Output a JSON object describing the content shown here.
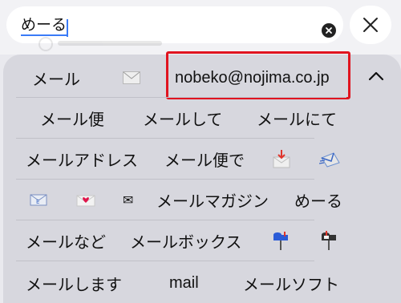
{
  "search": {
    "value": "めーる"
  },
  "candidates_row1": [
    {
      "label": "メール"
    },
    {
      "icon": "envelope-icon"
    },
    {
      "label": "nobeko@nojima.co.jp"
    }
  ],
  "candidates_row2": [
    "メール便",
    "メールして",
    "メールにて"
  ],
  "candidates_row3": [
    {
      "label": "メールアドレス"
    },
    {
      "label": "メール便で"
    },
    {
      "icon": "envelope-with-arrow-icon"
    },
    {
      "icon": "incoming-envelope-icon"
    }
  ],
  "candidates_row4": [
    {
      "icon": "e-mail-icon"
    },
    {
      "icon": "love-letter-icon"
    },
    {
      "icon": "small-envelope-icon",
      "glyph": "✉"
    },
    {
      "label": "メールマガジン"
    },
    {
      "label": "めーる"
    }
  ],
  "candidates_row5": [
    {
      "label": "メールなど"
    },
    {
      "label": "メールボックス"
    },
    {
      "icon": "mailbox-closed-icon"
    },
    {
      "icon": "mailbox-open-icon"
    }
  ],
  "candidates_row6": [
    "メールします",
    "mail",
    "メールソフト"
  ],
  "colors": {
    "highlight_border": "#e0141f",
    "cursor": "#3a7bf7"
  }
}
